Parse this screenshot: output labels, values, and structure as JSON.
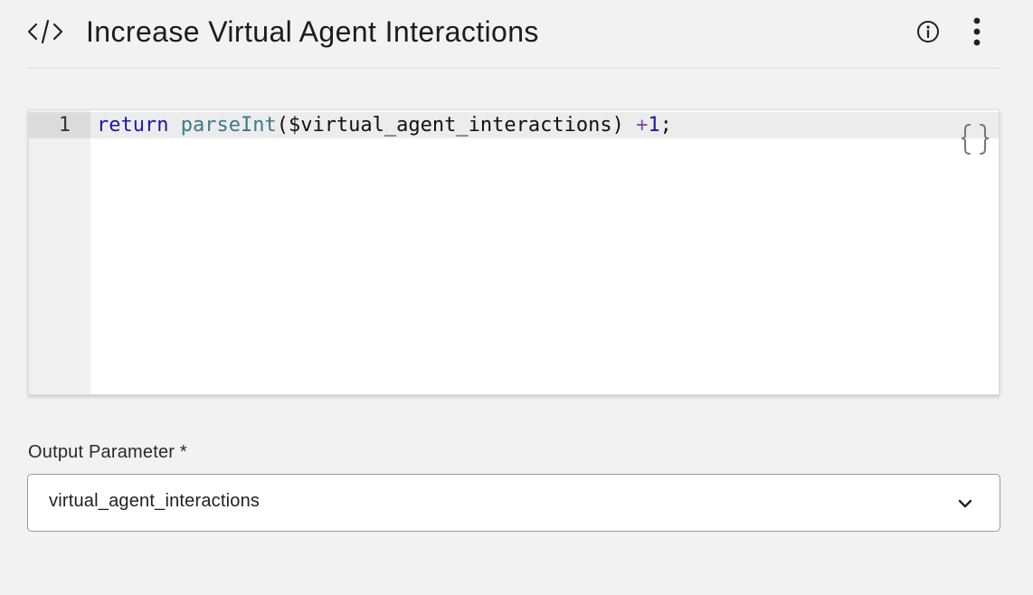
{
  "header": {
    "title": "Increase Virtual Agent Interactions",
    "leading_icon": "code-icon",
    "actions": [
      {
        "icon": "info-icon",
        "label": "Info"
      },
      {
        "icon": "more-vertical-icon",
        "label": "More options"
      }
    ]
  },
  "editor": {
    "lines": [
      {
        "number": "1",
        "tokens": {
          "keyword": "return",
          "space1": " ",
          "builtin": "parseInt",
          "open": "(",
          "variable": "$virtual_agent_interactions",
          "close": ")",
          "space2": " ",
          "operator": "+",
          "number": "1",
          "terminator": ";"
        }
      }
    ],
    "format_icon": "curly-braces-icon"
  },
  "output": {
    "label": "Output Parameter *",
    "selected_value": "virtual_agent_interactions",
    "dropdown_icon": "chevron-down-icon"
  },
  "colors": {
    "background": "#f2f2f2",
    "keyword": "#1a1aa6",
    "builtin": "#3b7a8c",
    "operator": "#7a4ab0"
  }
}
